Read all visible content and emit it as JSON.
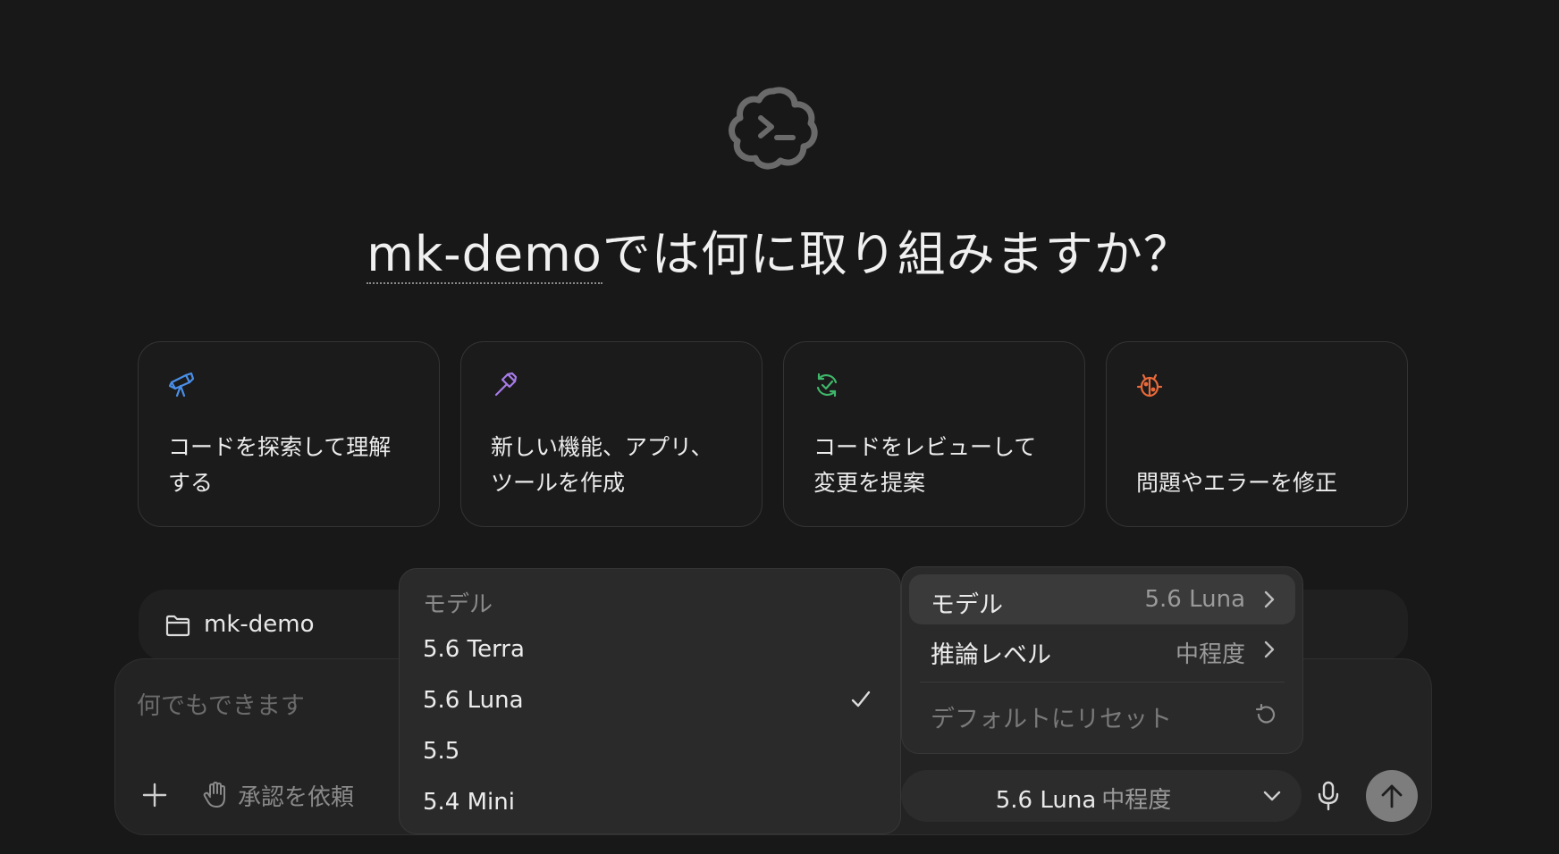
{
  "heading": {
    "project": "mk-demo",
    "rest": "では何に取り組みますか？"
  },
  "cards": [
    {
      "icon": "telescope-icon",
      "label": "コードを探索して理解\nする",
      "color": "#4a8fe8"
    },
    {
      "icon": "hammer-icon",
      "label": "新しい機能、アプリ、\nツールを作成",
      "color": "#a77be8"
    },
    {
      "icon": "refresh-check-icon",
      "label": "コードをレビューして\n変更を提案",
      "color": "#3fb76a"
    },
    {
      "icon": "bug-icon",
      "label": "問題やエラーを修正",
      "color": "#e86a3a"
    }
  ],
  "composer": {
    "folder_label": "mk-demo",
    "placeholder": "何でもできます",
    "approval_label": "承認を依頼",
    "model_selector": {
      "model": "5.6 Luna",
      "effort": "中程度"
    }
  },
  "model_menu": {
    "header": "モデル",
    "items": [
      {
        "label": "5.6 Terra",
        "selected": false
      },
      {
        "label": "5.6 Luna",
        "selected": true
      },
      {
        "label": "5.5",
        "selected": false
      },
      {
        "label": "5.4 Mini",
        "selected": false
      }
    ]
  },
  "settings_menu": {
    "model_label": "モデル",
    "model_value": "5.6 Luna",
    "reasoning_label": "推論レベル",
    "reasoning_value": "中程度",
    "reset_label": "デフォルトにリセット"
  }
}
